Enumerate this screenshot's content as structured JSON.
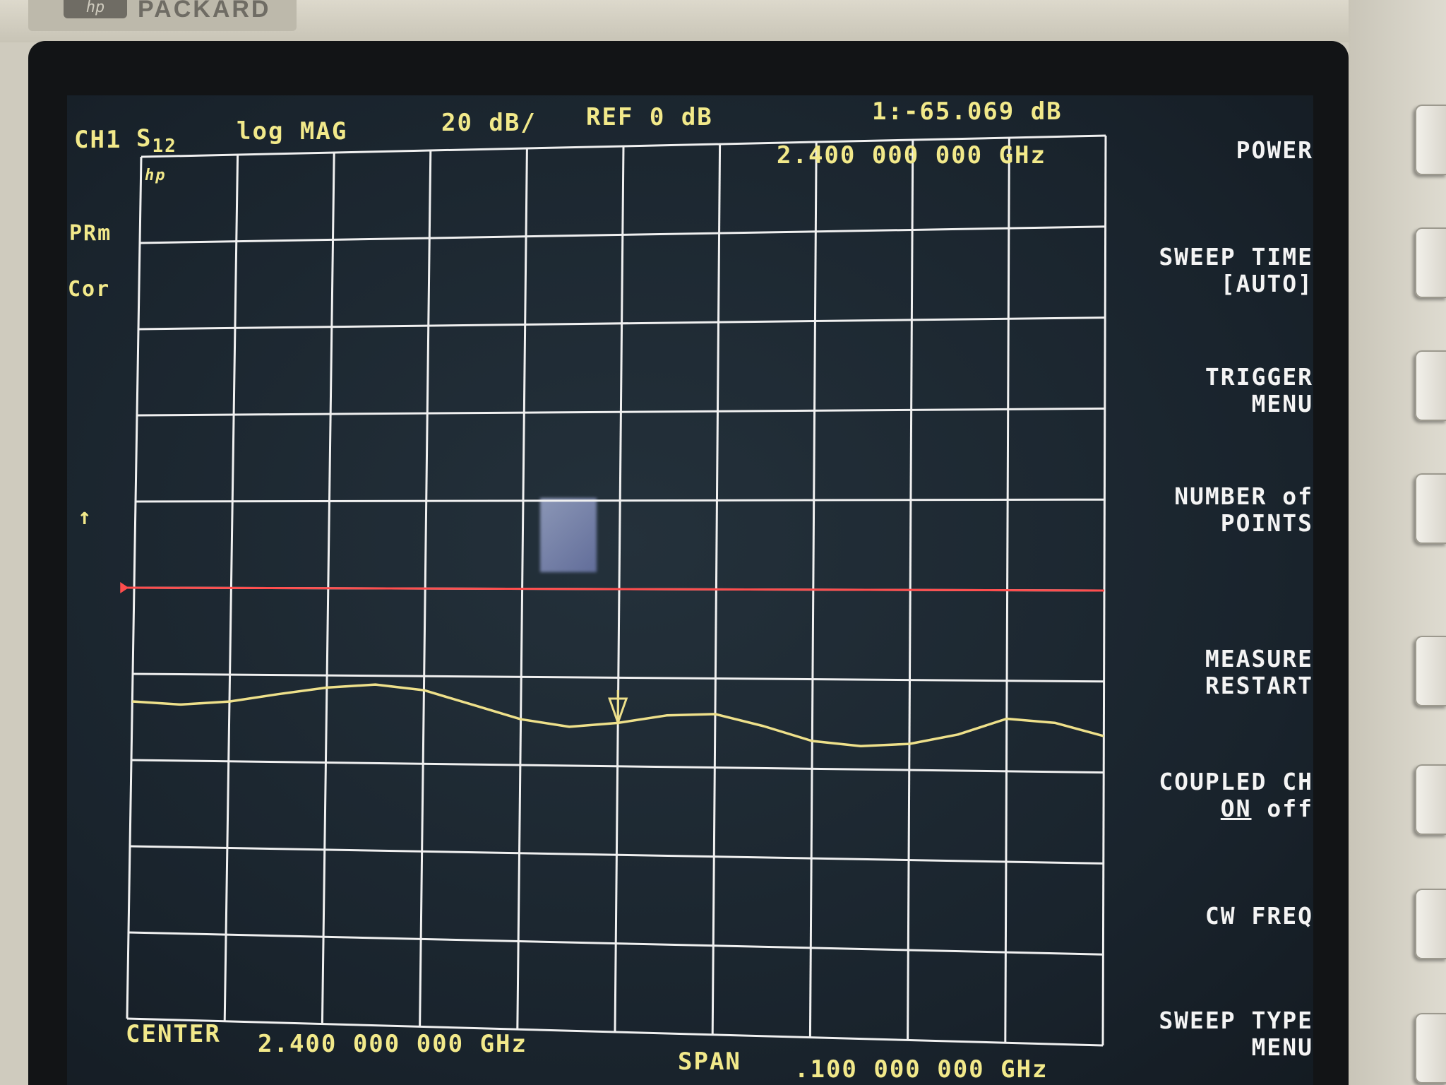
{
  "bezel": {
    "brand_logo": "hp",
    "brand_text": "PACKARD"
  },
  "header": {
    "channel": "CH1",
    "param": "S",
    "param_sub": "12",
    "format": "log MAG",
    "scale": "20 dB/",
    "reference": "REF 0 dB",
    "marker_readout": "1:-65.069 dB",
    "marker_freq": "2.400 000 000 GHz"
  },
  "left_annotations": {
    "hp_mark": "hp",
    "prm": "PRm",
    "cor": "Cor",
    "ref_arrow": "↑"
  },
  "footer": {
    "center_label": "CENTER",
    "center_value": "2.400 000 000 GHz",
    "span_label": "SPAN",
    "span_value": ".100 000 000 GHz"
  },
  "softkeys": [
    {
      "id": "power",
      "line1": "POWER",
      "line2": ""
    },
    {
      "id": "sweep-time",
      "line1": "SWEEP TIME",
      "line2": "[AUTO]"
    },
    {
      "id": "trigger-menu",
      "line1": "TRIGGER",
      "line2": "MENU"
    },
    {
      "id": "number-of-points",
      "line1": "NUMBER of",
      "line2": "POINTS"
    },
    {
      "id": "measure-restart",
      "line1": "MEASURE",
      "line2": "RESTART"
    },
    {
      "id": "coupled-ch",
      "line1": "COUPLED CH",
      "line2_on": "ON",
      "line2_off": "off"
    },
    {
      "id": "cw-freq",
      "line1": "CW FREQ",
      "line2": ""
    },
    {
      "id": "sweep-type-menu",
      "line1": "SWEEP TYPE",
      "line2": "MENU"
    }
  ],
  "colors": {
    "annotation": "#f2e98a",
    "softkey_text": "#f4f4f4",
    "grid": "#f0f0f0",
    "trace": "#eee08a",
    "reference_line": "#ff4d4d"
  },
  "chart_data": {
    "type": "line",
    "x_divisions": 10,
    "y_divisions": 10,
    "ylim": [
      -100,
      0
    ],
    "grid": true,
    "reference_level_db": 0,
    "marker": {
      "index": 1,
      "x_div": 5,
      "y_db": -65.069
    },
    "series": [
      {
        "x_div": [
          0,
          0.5,
          1,
          1.5,
          2,
          2.5,
          3,
          3.5,
          4,
          4.5,
          5,
          5.5,
          6,
          6.5,
          7,
          7.5,
          8,
          8.5,
          9,
          9.5,
          10
        ],
        "values": [
          -63.2,
          -63.5,
          -63.1,
          -62.2,
          -61.4,
          -61.0,
          -61.6,
          -63.2,
          -64.8,
          -65.6,
          -65.1,
          -64.2,
          -64.0,
          -65.3,
          -66.9,
          -67.4,
          -67.1,
          -66.0,
          -64.2,
          -64.6,
          -66.0
        ]
      }
    ]
  }
}
